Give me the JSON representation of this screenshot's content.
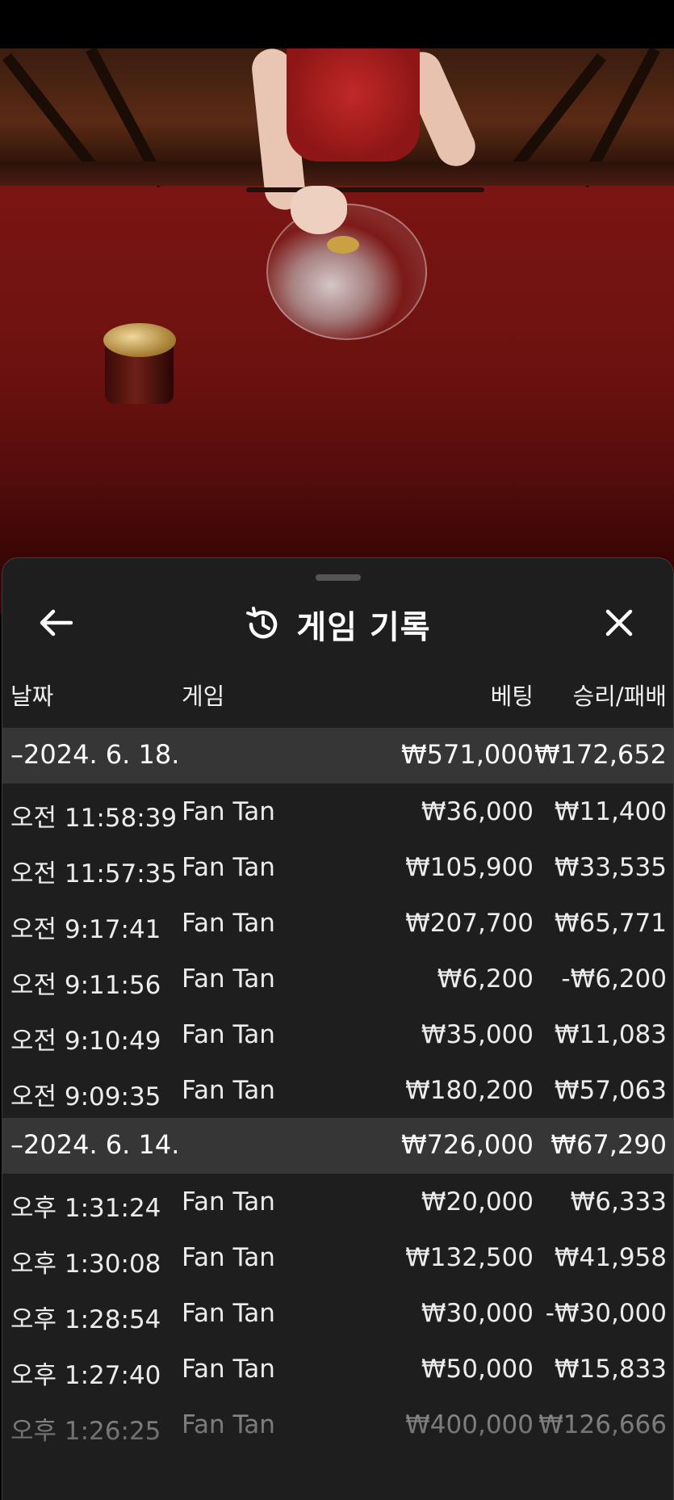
{
  "panel": {
    "title": "게임 기록",
    "back_icon": "arrow-left-icon",
    "history_icon": "history-icon",
    "close_icon": "close-icon"
  },
  "columns": {
    "date": "날짜",
    "game": "게임",
    "bet": "베팅",
    "win_loss": "승리/패배"
  },
  "groups": [
    {
      "date": "–2024. 6. 18.",
      "bet_total": "₩571,000",
      "win_total": "₩172,652",
      "rows": [
        {
          "time": "오전 11:58:39",
          "game": "Fan Tan",
          "bet": "₩36,000",
          "win": "₩11,400"
        },
        {
          "time": "오전 11:57:35",
          "game": "Fan Tan",
          "bet": "₩105,900",
          "win": "₩33,535"
        },
        {
          "time": "오전 9:17:41",
          "game": "Fan Tan",
          "bet": "₩207,700",
          "win": "₩65,771"
        },
        {
          "time": "오전 9:11:56",
          "game": "Fan Tan",
          "bet": "₩6,200",
          "win": "-₩6,200"
        },
        {
          "time": "오전 9:10:49",
          "game": "Fan Tan",
          "bet": "₩35,000",
          "win": "₩11,083"
        },
        {
          "time": "오전 9:09:35",
          "game": "Fan Tan",
          "bet": "₩180,200",
          "win": "₩57,063"
        }
      ]
    },
    {
      "date": "–2024. 6. 14.",
      "bet_total": "₩726,000",
      "win_total": "₩67,290",
      "rows": [
        {
          "time": "오후 1:31:24",
          "game": "Fan Tan",
          "bet": "₩20,000",
          "win": "₩6,333"
        },
        {
          "time": "오후 1:30:08",
          "game": "Fan Tan",
          "bet": "₩132,500",
          "win": "₩41,958"
        },
        {
          "time": "오후 1:28:54",
          "game": "Fan Tan",
          "bet": "₩30,000",
          "win": "-₩30,000"
        },
        {
          "time": "오후 1:27:40",
          "game": "Fan Tan",
          "bet": "₩50,000",
          "win": "₩15,833"
        },
        {
          "time": "오후 1:26:25",
          "game": "Fan Tan",
          "bet": "₩400,000",
          "win": "₩126,666"
        }
      ]
    }
  ]
}
